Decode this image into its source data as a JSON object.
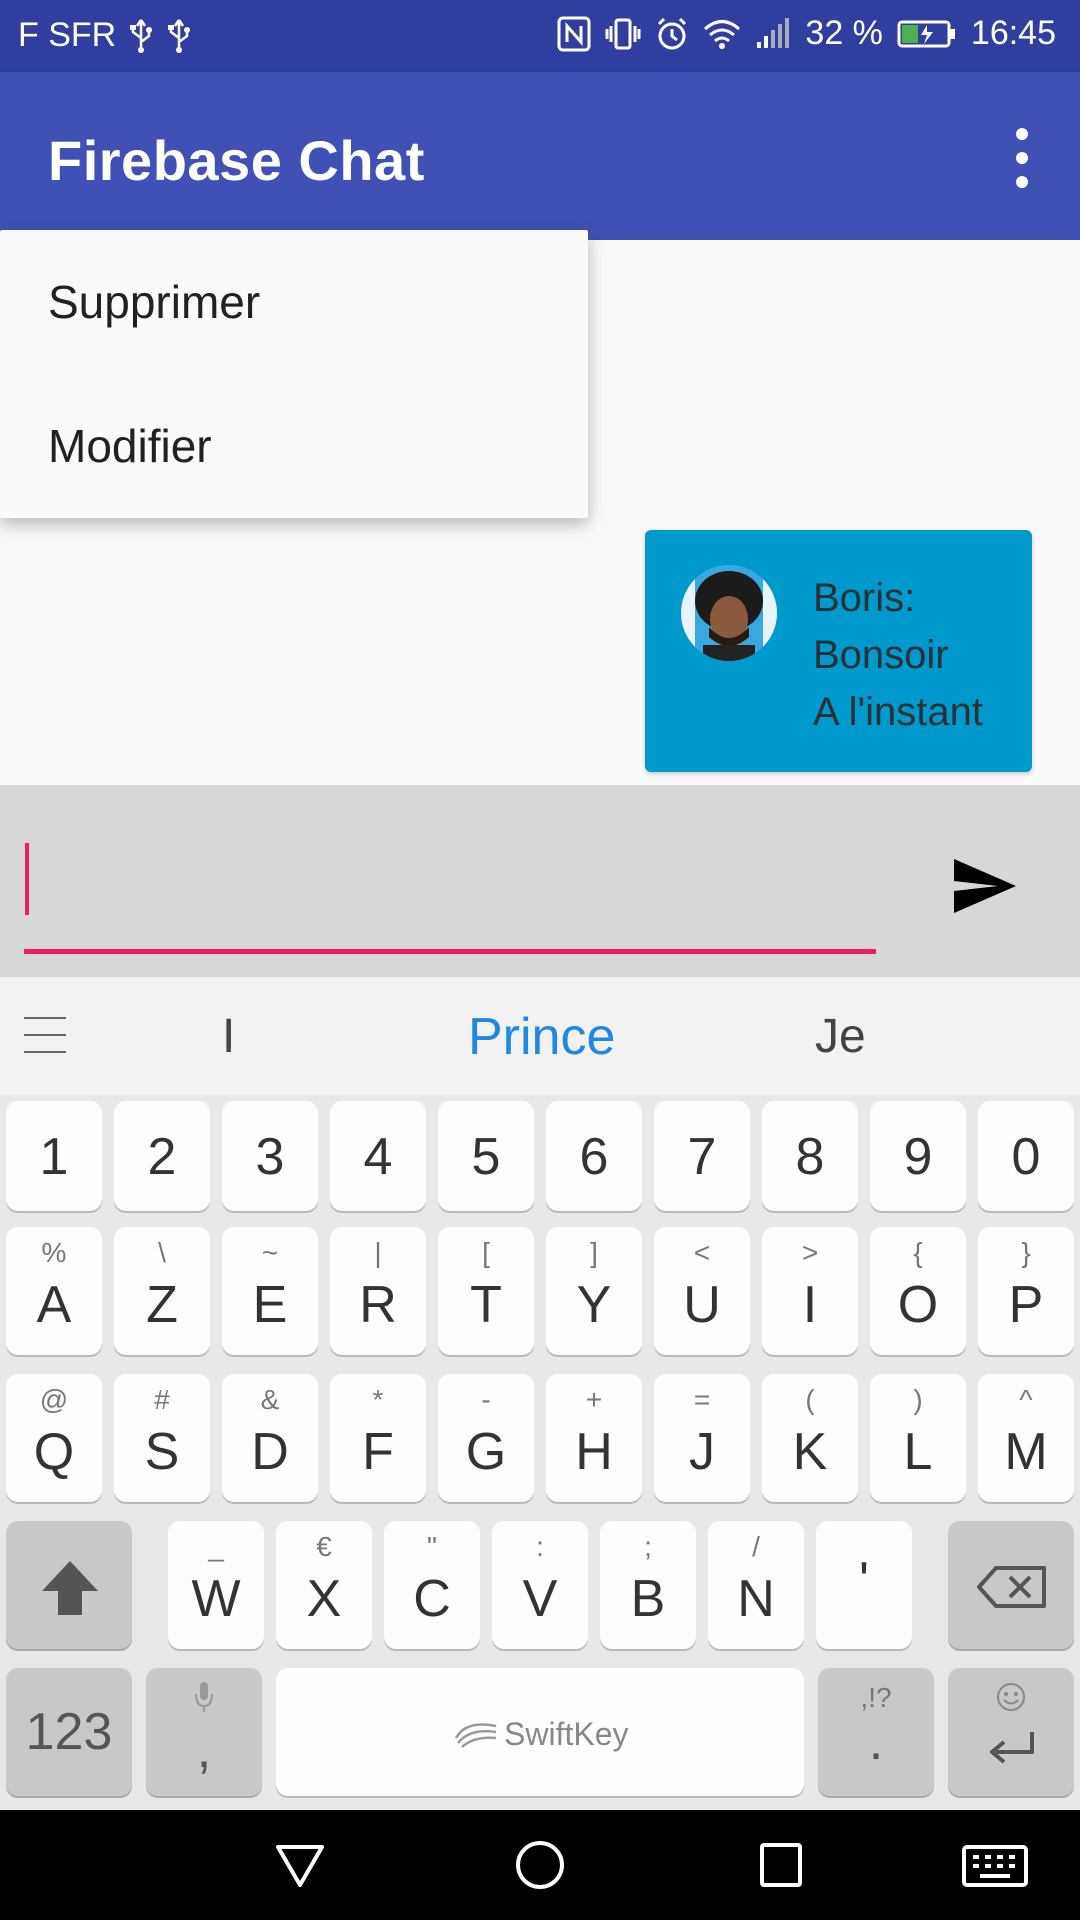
{
  "status_bar": {
    "carrier": "F SFR",
    "battery_percent": "32 %",
    "time": "16:45",
    "icons": [
      "usb-icon",
      "usb-icon",
      "nfc-icon",
      "vibrate-icon",
      "alarm-icon",
      "wifi-icon",
      "signal-icon",
      "battery-charging-icon"
    ]
  },
  "app_bar": {
    "title": "Firebase Chat",
    "overflow_icon": "more-vert-icon"
  },
  "popup_menu": {
    "items": [
      "Supprimer",
      "Modifier"
    ]
  },
  "messages": [
    {
      "sender": "Boris:",
      "text": "Bonsoir",
      "time": "A l'instant",
      "avatar": "user-avatar"
    }
  ],
  "composer": {
    "value": "",
    "send_icon": "send-icon"
  },
  "suggestions": {
    "menu_icon": "hamburger-icon",
    "items": [
      "I",
      "Prince",
      "Je"
    ]
  },
  "keyboard": {
    "number_row": [
      "1",
      "2",
      "3",
      "4",
      "5",
      "6",
      "7",
      "8",
      "9",
      "0"
    ],
    "row1": [
      {
        "main": "A",
        "sub": "%"
      },
      {
        "main": "Z",
        "sub": "\\"
      },
      {
        "main": "E",
        "sub": "~"
      },
      {
        "main": "R",
        "sub": "|"
      },
      {
        "main": "T",
        "sub": "["
      },
      {
        "main": "Y",
        "sub": "]"
      },
      {
        "main": "U",
        "sub": "<"
      },
      {
        "main": "I",
        "sub": ">"
      },
      {
        "main": "O",
        "sub": "{"
      },
      {
        "main": "P",
        "sub": "}"
      }
    ],
    "row2": [
      {
        "main": "Q",
        "sub": "@"
      },
      {
        "main": "S",
        "sub": "#"
      },
      {
        "main": "D",
        "sub": "&"
      },
      {
        "main": "F",
        "sub": "*"
      },
      {
        "main": "G",
        "sub": "-"
      },
      {
        "main": "H",
        "sub": "+"
      },
      {
        "main": "J",
        "sub": "="
      },
      {
        "main": "K",
        "sub": "("
      },
      {
        "main": "L",
        "sub": ")"
      },
      {
        "main": "M",
        "sub": "^"
      }
    ],
    "row3": [
      {
        "main": "W",
        "sub": "_"
      },
      {
        "main": "X",
        "sub": "€"
      },
      {
        "main": "C",
        "sub": "\""
      },
      {
        "main": "V",
        "sub": ":"
      },
      {
        "main": "B",
        "sub": ";"
      },
      {
        "main": "N",
        "sub": "/"
      },
      {
        "main": "'",
        "sub": ""
      }
    ],
    "numbers_key": "123",
    "comma_key": ",",
    "space_label": "SwiftKey",
    "period_key": ".",
    "period_sub": ",!?",
    "shift_icon": "shift-icon",
    "backspace_icon": "backspace-icon",
    "mic_icon": "mic-icon",
    "emoji_icon": "emoji-icon",
    "enter_icon": "enter-icon"
  },
  "nav_bar": {
    "icons": [
      "back-icon",
      "home-icon",
      "recents-icon",
      "keyboard-icon"
    ]
  },
  "colors": {
    "status_bar": "#303f9f",
    "primary": "#3f51b5",
    "accent": "#e91e63",
    "bubble": "#0099cc",
    "suggestion_highlight": "#1e88e5"
  }
}
